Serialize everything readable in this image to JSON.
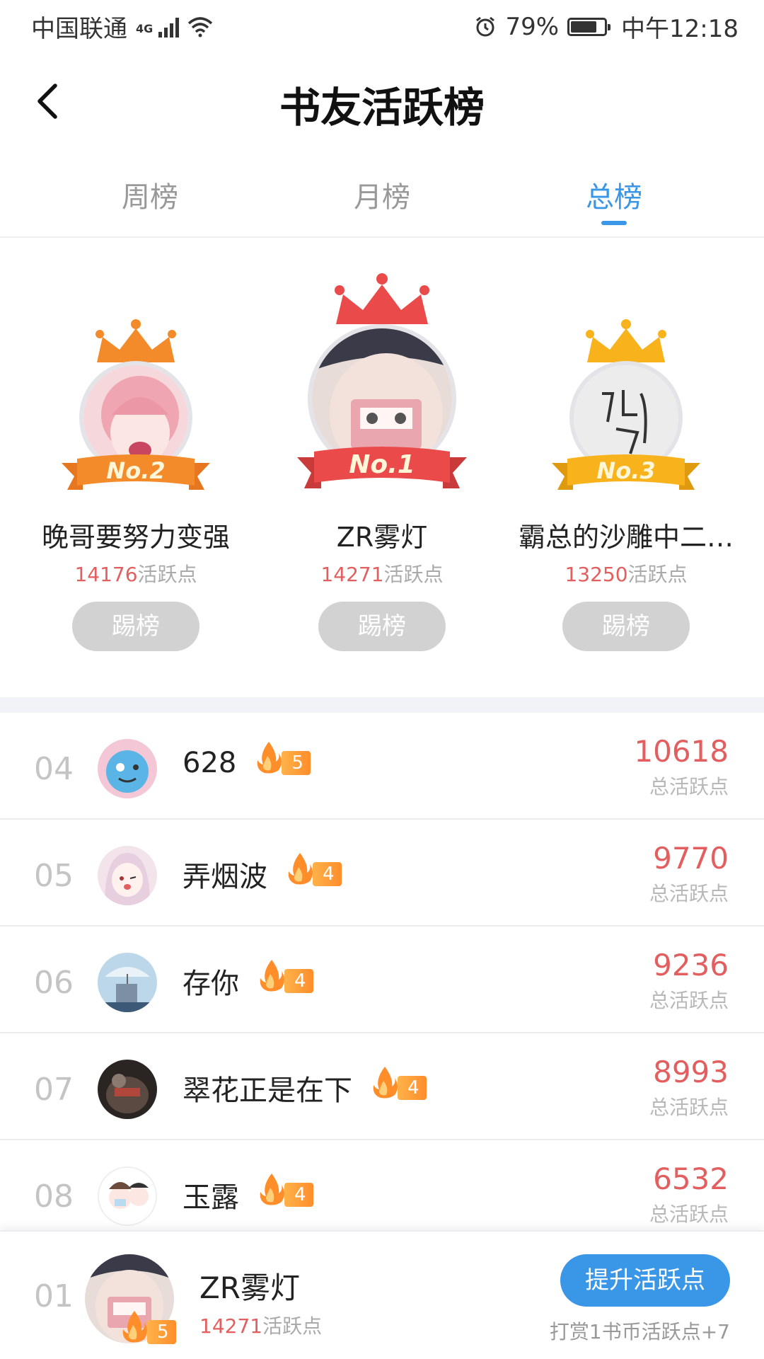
{
  "status": {
    "carrier": "中国联通",
    "network": "4G",
    "battery": "79%",
    "battery_level": 0.79,
    "time": "中午12:18"
  },
  "header": {
    "title": "书友活跃榜"
  },
  "tabs": [
    {
      "label": "周榜",
      "active": false
    },
    {
      "label": "月榜",
      "active": false
    },
    {
      "label": "总榜",
      "active": true
    }
  ],
  "podium": {
    "first": {
      "rank_label": "No.1",
      "name": "ZR雾灯",
      "score": "14271",
      "unit": "活跃点",
      "button": "踢榜"
    },
    "second": {
      "rank_label": "No.2",
      "name": "晚哥要努力变强",
      "score": "14176",
      "unit": "活跃点",
      "button": "踢榜"
    },
    "third": {
      "rank_label": "No.3",
      "name": "霸总的沙雕中二…",
      "score": "13250",
      "unit": "活跃点",
      "button": "踢榜"
    }
  },
  "list": [
    {
      "rank": "04",
      "name": "628",
      "level": "5",
      "score": "10618",
      "label": "总活跃点"
    },
    {
      "rank": "05",
      "name": "弄烟波",
      "level": "4",
      "score": "9770",
      "label": "总活跃点"
    },
    {
      "rank": "06",
      "name": "存你",
      "level": "4",
      "score": "9236",
      "label": "总活跃点"
    },
    {
      "rank": "07",
      "name": "翠花正是在下",
      "level": "4",
      "score": "8993",
      "label": "总活跃点"
    },
    {
      "rank": "08",
      "name": "玉露",
      "level": "4",
      "score": "6532",
      "label": "总活跃点"
    }
  ],
  "me": {
    "rank": "01",
    "name": "ZR雾灯",
    "level": "5",
    "score": "14271",
    "unit": "活跃点",
    "button": "提升活跃点",
    "tip": "打赏1书币活跃点+7"
  },
  "colors": {
    "accent": "#3a96e6",
    "score_red": "#e35f5f",
    "gold": "#f7b21c",
    "silver_orange": "#f48b2a",
    "red": "#ea4a4a"
  }
}
